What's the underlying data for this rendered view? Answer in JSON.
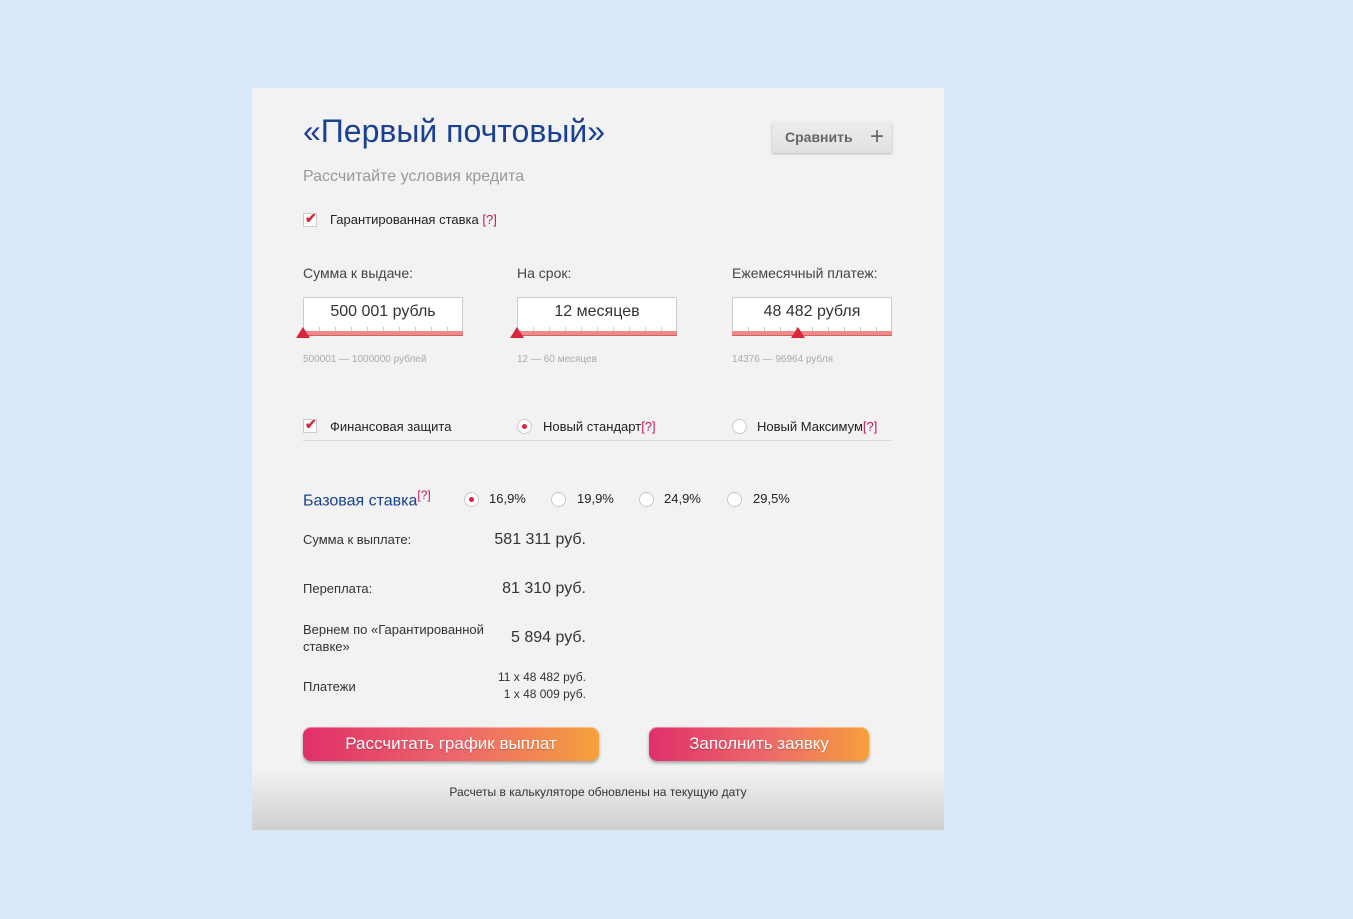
{
  "product": {
    "title": "«Первый почтовый»",
    "subtitle": "Рассчитайте условия кредита",
    "compare_label": "Сравнить",
    "compare_plus": "+"
  },
  "guaranteed_rate": {
    "label": "Гарантированная ставка",
    "help": "[?]",
    "checked": true
  },
  "fields": {
    "amount": {
      "label": "Сумма к выдаче:",
      "value": "500 001 рубль",
      "range": "500001 — 1000000 рублей",
      "slider_fraction": 0
    },
    "term": {
      "label": "На срок:",
      "value": "12 месяцев",
      "range": "12 — 60 месяцев",
      "slider_fraction": 0
    },
    "monthly": {
      "label": "Ежемесячный платеж:",
      "value": "48 482 рубля",
      "range": "14376 — 96964 рубля",
      "slider_fraction": 0.41
    }
  },
  "protection": {
    "financial": {
      "label": "Финансовая защита",
      "checked": true
    },
    "new_standard": {
      "label": "Новый стандарт",
      "help": "[?]",
      "selected": true
    },
    "new_maximum": {
      "label": "Новый Максимум",
      "help": "[?]",
      "selected": false
    }
  },
  "base_rate": {
    "label": "Базовая ставка",
    "help": "[?]",
    "options": [
      "16,9%",
      "19,9%",
      "24,9%",
      "29,5%"
    ],
    "selected": "16,9%"
  },
  "results": {
    "total_label": "Сумма к выплате:",
    "total_value": "581 311 руб.",
    "overpay_label": "Переплата:",
    "overpay_value": "81 310 руб.",
    "refund_label_line1": "Вернем по «Гарантированной",
    "refund_label_line2": "ставке»",
    "refund_value": "5 894 руб.",
    "payments_label": "Платежи",
    "payments_line1": "11 x 48 482 руб.",
    "payments_line2": "1 x 48 009 руб."
  },
  "actions": {
    "schedule_label": "Рассчитать график выплат",
    "apply_label": "Заполнить заявку"
  },
  "footnote": "Расчеты в калькуляторе обновлены на текущую дату",
  "colors": {
    "page_bg": "#d9e8f9",
    "panel_bg": "#f2f2f2",
    "title": "#1a4093",
    "accent_red": "#e5203a",
    "help_link": "#c2185b"
  }
}
